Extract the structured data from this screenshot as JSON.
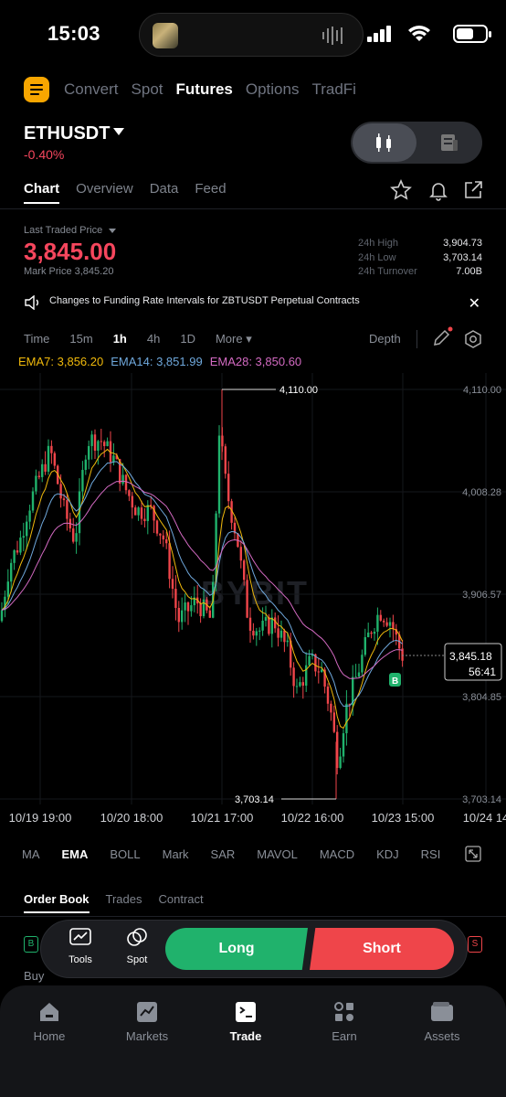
{
  "status": {
    "time": "15:03"
  },
  "topnav": {
    "items": [
      "Convert",
      "Spot",
      "Futures",
      "Options",
      "TradFi"
    ],
    "active": "Futures"
  },
  "ticker": {
    "pair": "ETHUSDT",
    "change": "-0.40%"
  },
  "tabs": {
    "items": [
      "Chart",
      "Overview",
      "Data",
      "Feed"
    ],
    "active": "Chart"
  },
  "price_info": {
    "label": "Last Traded Price",
    "last": "3,845.00",
    "mark": "Mark Price 3,845.20",
    "stats": [
      {
        "k": "24h High",
        "v": "3,904.73"
      },
      {
        "k": "24h Low",
        "v": "3,703.14"
      },
      {
        "k": "24h Turnover",
        "v": "7.00B"
      }
    ]
  },
  "notice": {
    "text": "Changes to Funding Rate Intervals for ZBTUSDT Perpetual Contracts"
  },
  "timebar": {
    "items": [
      "Time",
      "15m",
      "1h",
      "4h",
      "1D",
      "More"
    ],
    "active": "1h",
    "depth": "Depth"
  },
  "ema": [
    {
      "label": "EMA7: 3,856.20",
      "color": "#f0b90b"
    },
    {
      "label": "EMA14: 3,851.99",
      "color": "#6fa8dc"
    },
    {
      "label": "EMA28: 3,850.60",
      "color": "#d36ac2"
    }
  ],
  "chart": {
    "watermark": "BYBIT",
    "y_ticks": [
      "4,110.00",
      "4,008.28",
      "3,906.57",
      "3,804.85",
      "3,703.14"
    ],
    "x_ticks": [
      "10/19 19:00",
      "10/20 18:00",
      "10/21 17:00",
      "10/22 16:00",
      "10/23 15:00",
      "10/24 14"
    ],
    "high_label": "4,110.00",
    "low_label": "3,703.14",
    "current_price": "3,845.18",
    "countdown": "56:41",
    "marker": "B"
  },
  "indicators": {
    "items": [
      "MA",
      "EMA",
      "BOLL",
      "Mark",
      "SAR",
      "MAVOL",
      "MACD",
      "KDJ",
      "RSI"
    ],
    "active": "EMA"
  },
  "orderbook": {
    "tabs": [
      "Order Book",
      "Trades",
      "Contract"
    ],
    "active": "Order Book",
    "buy_label": "Buy"
  },
  "action_bar": {
    "tools": "Tools",
    "spot": "Spot",
    "long": "Long",
    "short": "Short"
  },
  "bottom_nav": {
    "items": [
      "Home",
      "Markets",
      "Trade",
      "Earn",
      "Assets"
    ],
    "active": "Trade"
  },
  "colors": {
    "up": "#20b26c",
    "down": "#ef454a",
    "accent": "#f7a600"
  }
}
